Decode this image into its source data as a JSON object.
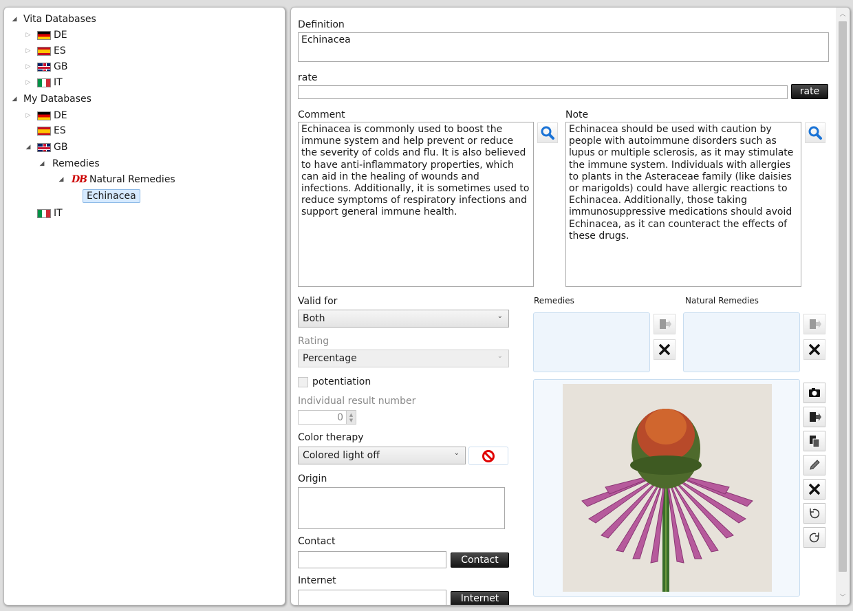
{
  "tree": {
    "vita_root": "Vita Databases",
    "vita": [
      "DE",
      "ES",
      "GB",
      "IT"
    ],
    "my_root": "My Databases",
    "my": [
      "DE",
      "ES",
      "GB",
      "IT"
    ],
    "remedies": "Remedies",
    "natural_remedies": "Natural Remedies",
    "db_icon_text": "DB",
    "selected": "Echinacea"
  },
  "form": {
    "definition_label": "Definition",
    "definition_value": "Echinacea",
    "rate_label": "rate",
    "rate_value": "",
    "rate_button": "rate",
    "comment_label": "Comment",
    "comment_text": "Echinacea is commonly used to boost the immune system and help prevent or reduce the severity of colds and flu. It is also believed to have anti-inflammatory properties, which can aid in the healing of wounds and infections. Additionally, it is sometimes used to reduce symptoms of respiratory infections and support general immune health.",
    "note_label": "Note",
    "note_text": "Echinacea should be used with caution by people with autoimmune disorders such as lupus or multiple sclerosis, as it may stimulate the immune system. Individuals with allergies to plants in the Asteraceae family (like daisies or marigolds) could have allergic reactions to Echinacea. Additionally, those taking immunosuppressive medications should avoid Echinacea, as it can counteract the effects of these drugs.",
    "valid_for_label": "Valid for",
    "valid_for_value": "Both",
    "rating_label": "Rating",
    "rating_value": "Percentage",
    "potentiation_label": "potentiation",
    "individual_label": "Individual result number",
    "individual_value": "0",
    "color_label": "Color therapy",
    "color_value": "Colored light off",
    "origin_label": "Origin",
    "origin_value": "",
    "contact_label": "Contact",
    "contact_value": "",
    "contact_button": "Contact",
    "internet_label": "Internet",
    "internet_value": "",
    "internet_button": "Internet",
    "remedies_label": "Remedies",
    "natural_remedies_label": "Natural Remedies"
  },
  "colors": {
    "accent": "#1a73d6",
    "selection": "#d6eaff",
    "panel": "#eef5fc"
  }
}
